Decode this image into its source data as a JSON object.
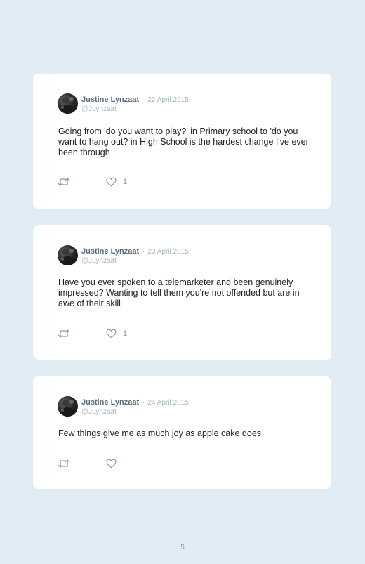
{
  "tweets": [
    {
      "author": "Justine Lynzaat",
      "separator": "·",
      "date": "22 April 2015",
      "handle": "@JLynzaat",
      "text": "Going from 'do you want to play?' in Primary school to 'do you want to hang out? in High School is the hardest change I've ever been through",
      "likes": "1",
      "icons": [
        "retweet-icon",
        "heart-icon"
      ]
    },
    {
      "author": "Justine Lynzaat",
      "separator": "·",
      "date": "23 April 2015",
      "handle": "@JLynzaat",
      "text": "Have you ever spoken to a telemarketer and been genuinely impressed? Wanting to tell them you're not offended but are in awe of their skill",
      "likes": "1",
      "icons": [
        "retweet-icon",
        "heart-icon"
      ]
    },
    {
      "author": "Justine Lynzaat",
      "separator": "·",
      "date": "24 April 2015",
      "handle": "@JLynzaat",
      "text": "Few things give me as much joy as apple cake does",
      "likes": "",
      "icons": [
        "retweet-icon",
        "heart-icon"
      ]
    }
  ],
  "page_number": "5",
  "colors": {
    "background": "#e1edf5",
    "card": "#ffffff",
    "author": "#5c6c7b",
    "meta": "#a9b4bd",
    "text": "#222222",
    "icon": "#8a98a5"
  }
}
